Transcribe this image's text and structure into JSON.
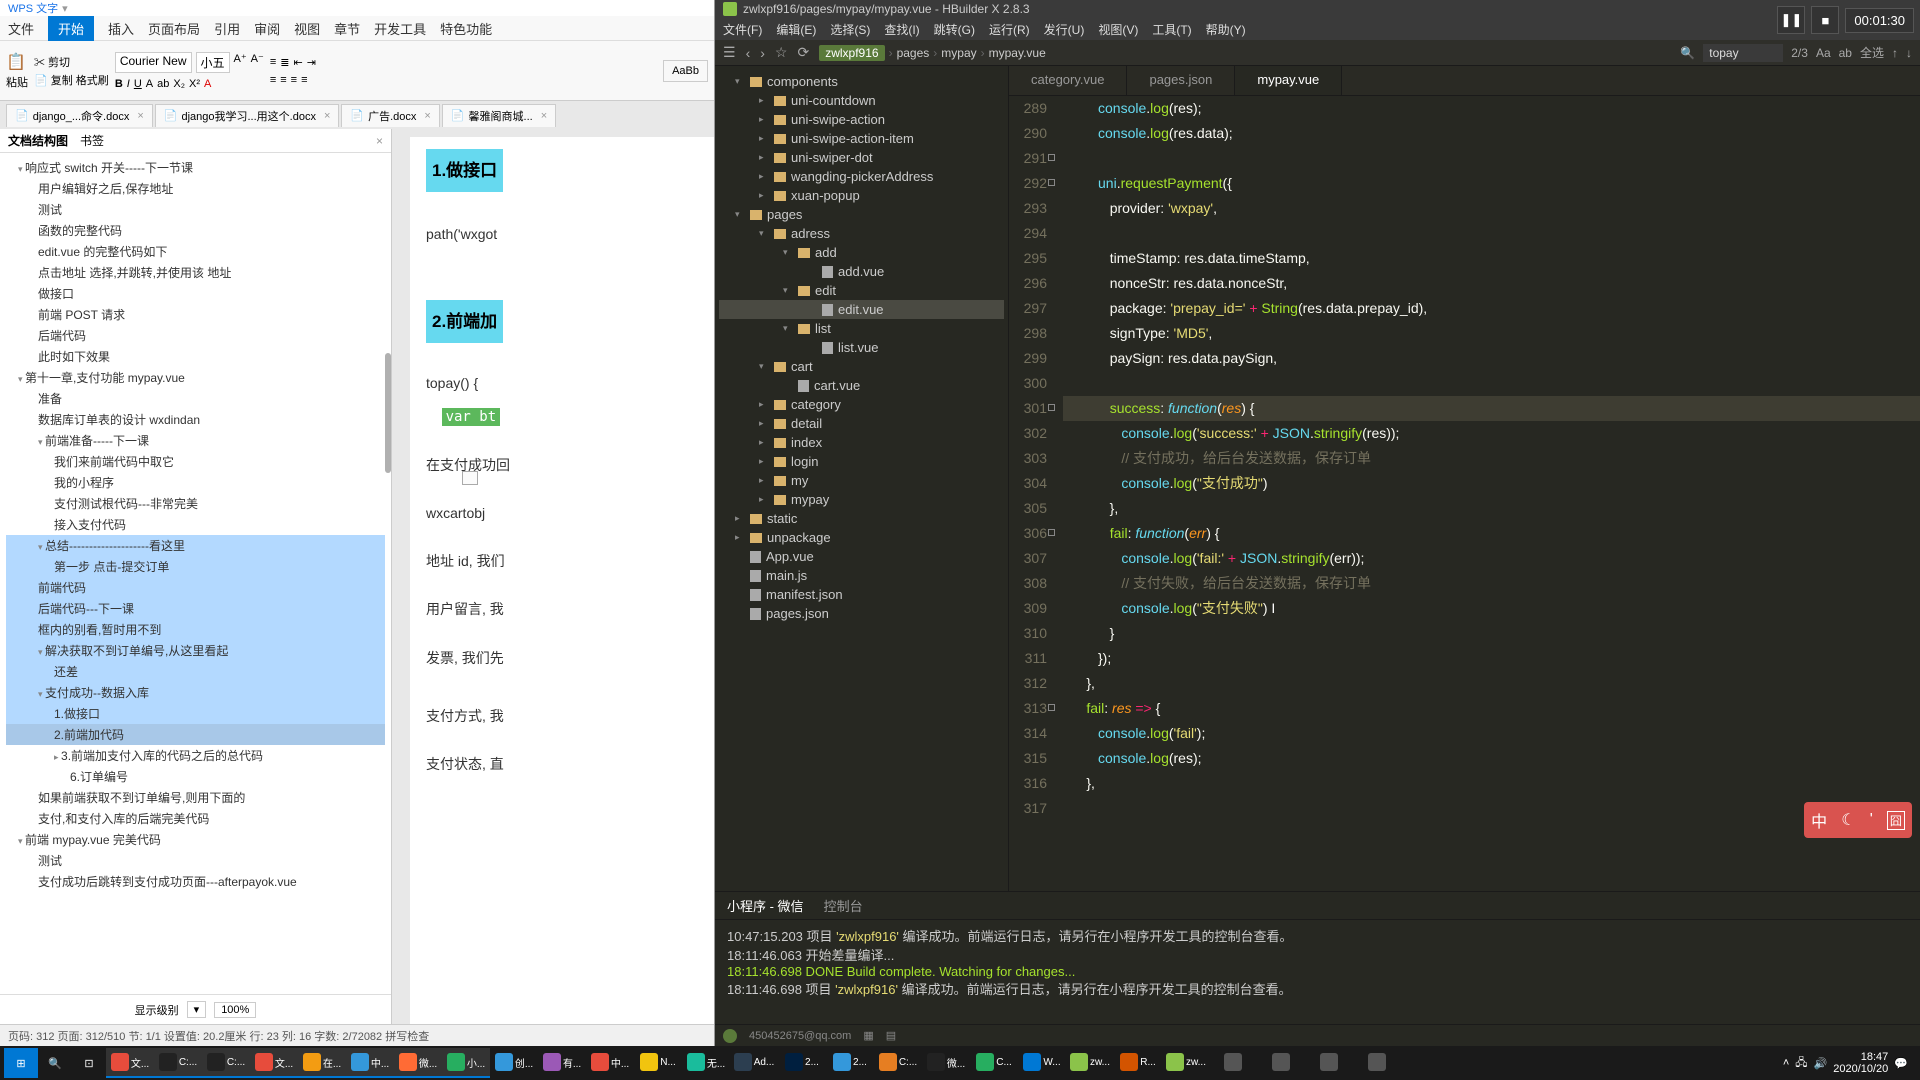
{
  "wps": {
    "app_title": "WPS 文字",
    "menu": [
      "文件",
      "开始",
      "插入",
      "页面布局",
      "引用",
      "审阅",
      "视图",
      "章节",
      "开发工具",
      "特色功能"
    ],
    "menu_active": 1,
    "font_name": "Courier New",
    "font_size": "小五",
    "tabs": [
      {
        "label": "django_...命令.docx"
      },
      {
        "label": "django我学习...用这个.docx"
      },
      {
        "label": "广告.docx"
      },
      {
        "label": "馨雅阁商城..."
      }
    ],
    "outline_tabs": [
      "文档结构图",
      "书签"
    ],
    "outline": [
      {
        "t": "响应式 switch 开关-----下一节课",
        "l": 1,
        "caret": true,
        "open": true
      },
      {
        "t": "用户编辑好之后,保存地址",
        "l": 2
      },
      {
        "t": "测试",
        "l": 2
      },
      {
        "t": "函数的完整代码",
        "l": 2
      },
      {
        "t": "edit.vue 的完整代码如下",
        "l": 2
      },
      {
        "t": "点击地址 选择,并跳转,并使用该 地址",
        "l": 2
      },
      {
        "t": "做接口",
        "l": 2
      },
      {
        "t": "前端 POST 请求",
        "l": 2
      },
      {
        "t": "后端代码",
        "l": 2
      },
      {
        "t": "此时如下效果",
        "l": 2
      },
      {
        "t": "第十一章,支付功能  mypay.vue",
        "l": 1,
        "caret": true,
        "open": true
      },
      {
        "t": "准备",
        "l": 2
      },
      {
        "t": "数据库订单表的设计  wxdindan",
        "l": 2
      },
      {
        "t": "前端准备-----下一课",
        "l": 2,
        "caret": true,
        "open": true
      },
      {
        "t": "我们来前端代码中取它",
        "l": 3
      },
      {
        "t": "我的小程序",
        "l": 3
      },
      {
        "t": "支付测试根代码---非常完美",
        "l": 3
      },
      {
        "t": "接入支付代码",
        "l": 3
      },
      {
        "t": "总结--------------------看这里",
        "l": 2,
        "hi": true,
        "caret": true,
        "open": true
      },
      {
        "t": "第一步 点击-提交订单",
        "l": 3,
        "hi": true
      },
      {
        "t": "前端代码",
        "l": 2,
        "hi": true
      },
      {
        "t": "后端代码---下一课",
        "l": 2,
        "hi": true
      },
      {
        "t": "框内的别看,暂时用不到",
        "l": 2,
        "hi": true
      },
      {
        "t": "解决获取不到订单编号,从这里看起",
        "l": 2,
        "hi": true,
        "caret": true,
        "open": true
      },
      {
        "t": "还差",
        "l": 3,
        "hi": true
      },
      {
        "t": "支付成功--数据入库",
        "l": 2,
        "hi": true,
        "caret": true,
        "open": true
      },
      {
        "t": "1.做接口",
        "l": 3,
        "hi": true
      },
      {
        "t": "2.前端加代码",
        "l": 3,
        "se": true
      },
      {
        "t": "3.前端加支付入库的代码之后的总代码",
        "l": 3,
        "caret": true
      },
      {
        "t": "6.订单编号",
        "l": 4
      },
      {
        "t": "如果前端获取不到订单编号,则用下面的",
        "l": 2
      },
      {
        "t": "支付,和支付入库的后端完美代码",
        "l": 2
      },
      {
        "t": "前端 mypay.vue 完美代码",
        "l": 1,
        "caret": true,
        "open": true
      },
      {
        "t": "测试",
        "l": 2
      },
      {
        "t": "支付成功后跳转到支付成功页面---afterpayok.vue",
        "l": 2
      }
    ],
    "outline_level_label": "显示级别",
    "outline_zoom": "100%",
    "doc": {
      "h1": "1.做接口",
      "path_line": "path('wxgot",
      "h2": "2.前端加",
      "topay": "topay() {",
      "var_bt": "var bt",
      "l1": "在支付成功回",
      "l2": "wxcartobj",
      "l3": "地址 id, 我们",
      "l4": "用户留言, 我",
      "l5": "发票, 我们先",
      "l6": "支付方式, 我",
      "l7": "支付状态, 直"
    },
    "status": "页码: 312  页面: 312/510  节: 1/1  设置值: 20.2厘米  行: 23  列: 16  字数: 2/72082  拼写检查"
  },
  "hb": {
    "title": "zwlxpf916/pages/mypay/mypay.vue - HBuilder X 2.8.3",
    "menu": [
      "文件(F)",
      "编辑(E)",
      "选择(S)",
      "查找(I)",
      "跳转(G)",
      "运行(R)",
      "发行(U)",
      "视图(V)",
      "工具(T)",
      "帮助(Y)"
    ],
    "crumb": [
      "zwlxpf916",
      "pages",
      "mypay",
      "mypay.vue"
    ],
    "search_value": "topay",
    "search_count": "2/3",
    "search_all": "全选",
    "tree": [
      {
        "t": "components",
        "l": 1,
        "folder": true,
        "open": true
      },
      {
        "t": "uni-countdown",
        "l": 2,
        "folder": true
      },
      {
        "t": "uni-swipe-action",
        "l": 2,
        "folder": true
      },
      {
        "t": "uni-swipe-action-item",
        "l": 2,
        "folder": true
      },
      {
        "t": "uni-swiper-dot",
        "l": 2,
        "folder": true
      },
      {
        "t": "wangding-pickerAddress",
        "l": 2,
        "folder": true
      },
      {
        "t": "xuan-popup",
        "l": 2,
        "folder": true
      },
      {
        "t": "pages",
        "l": 1,
        "folder": true,
        "open": true
      },
      {
        "t": "adress",
        "l": 2,
        "folder": true,
        "open": true
      },
      {
        "t": "add",
        "l": 3,
        "folder": true,
        "open": true
      },
      {
        "t": "add.vue",
        "l": 4
      },
      {
        "t": "edit",
        "l": 3,
        "folder": true,
        "open": true
      },
      {
        "t": "edit.vue",
        "l": 4,
        "sel": true
      },
      {
        "t": "list",
        "l": 3,
        "folder": true,
        "open": true
      },
      {
        "t": "list.vue",
        "l": 4
      },
      {
        "t": "cart",
        "l": 2,
        "folder": true,
        "open": true
      },
      {
        "t": "cart.vue",
        "l": 3
      },
      {
        "t": "category",
        "l": 2,
        "folder": true
      },
      {
        "t": "detail",
        "l": 2,
        "folder": true
      },
      {
        "t": "index",
        "l": 2,
        "folder": true
      },
      {
        "t": "login",
        "l": 2,
        "folder": true
      },
      {
        "t": "my",
        "l": 2,
        "folder": true
      },
      {
        "t": "mypay",
        "l": 2,
        "folder": true
      },
      {
        "t": "static",
        "l": 1,
        "folder": true
      },
      {
        "t": "unpackage",
        "l": 1,
        "folder": true
      },
      {
        "t": "App.vue",
        "l": 1
      },
      {
        "t": "main.js",
        "l": 1
      },
      {
        "t": "manifest.json",
        "l": 1
      },
      {
        "t": "pages.json",
        "l": 1
      }
    ],
    "tabs": [
      "category.vue",
      "pages.json",
      "mypay.vue"
    ],
    "tab_active": 2,
    "code_start": 289,
    "console": {
      "tabs": [
        "小程序 - 微信",
        "控制台"
      ],
      "lines": [
        {
          "ts": "10:47:15.203",
          "txt": "项目 'zwlxpf916' 编译成功。前端运行日志，请另行在小程序开发工具的控制台查看。"
        },
        {
          "ts": "18:11:46.063",
          "txt": "开始差量编译..."
        },
        {
          "ts": "18:11:46.698",
          "txt": "DONE  Build complete. Watching for changes...",
          "ok": true
        },
        {
          "ts": "18:11:46.698",
          "txt": "项目 'zwlxpf916' 编译成功。前端运行日志，请另行在小程序开发工具的控制台查看。"
        }
      ],
      "user": "450452675@qq.com"
    }
  },
  "rec": {
    "time": "00:01:30"
  },
  "ime": [
    "中",
    "☾",
    "'",
    "囧"
  ],
  "clock": {
    "time": "18:47",
    "date": "2020/10/20"
  },
  "task_apps": [
    "文...",
    "C:...",
    "C:...",
    "文...",
    "在...",
    "中...",
    "微...",
    "小...",
    "创...",
    "有...",
    "中...",
    "N...",
    "无...",
    "Ad...",
    "2...",
    "2...",
    "C:...",
    "微...",
    "C...",
    "W...",
    "zw...",
    "R...",
    "zw...",
    "",
    "",
    "",
    ""
  ]
}
